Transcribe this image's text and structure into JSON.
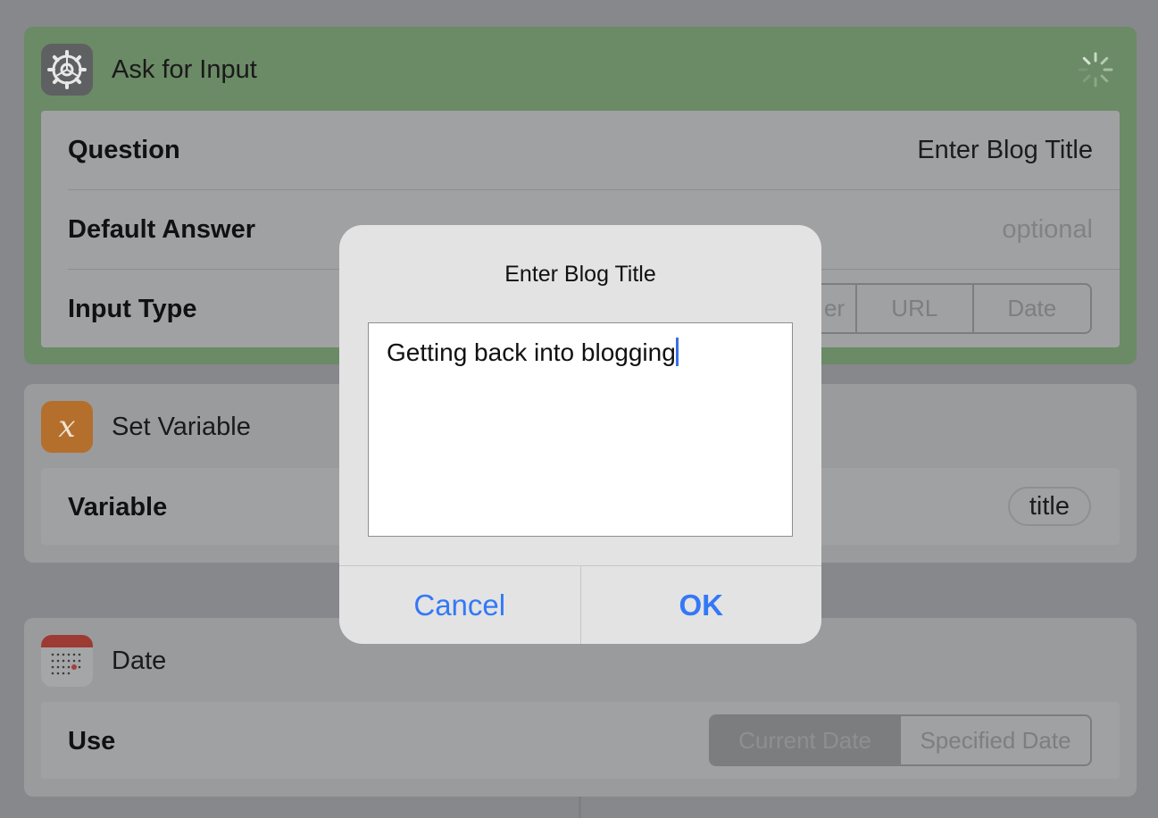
{
  "ask_for_input": {
    "title": "Ask for Input",
    "icon": "gear-icon",
    "question_label": "Question",
    "question_value": "Enter Blog Title",
    "default_answer_label": "Default Answer",
    "default_answer_placeholder": "optional",
    "input_type_label": "Input Type",
    "input_type_options": [
      "er",
      "URL",
      "Date"
    ]
  },
  "set_variable": {
    "title": "Set Variable",
    "icon": "variable-x-icon",
    "variable_label": "Variable",
    "variable_value": "title"
  },
  "date_action": {
    "title": "Date",
    "icon": "calendar-icon",
    "use_label": "Use",
    "use_options": [
      "Current Date",
      "Specified Date"
    ],
    "selected_option": "Current Date"
  },
  "dialog": {
    "title": "Enter Blog Title",
    "input_value": "Getting back into blogging",
    "cancel_label": "Cancel",
    "ok_label": "OK",
    "accent_color": "#3478f6"
  }
}
